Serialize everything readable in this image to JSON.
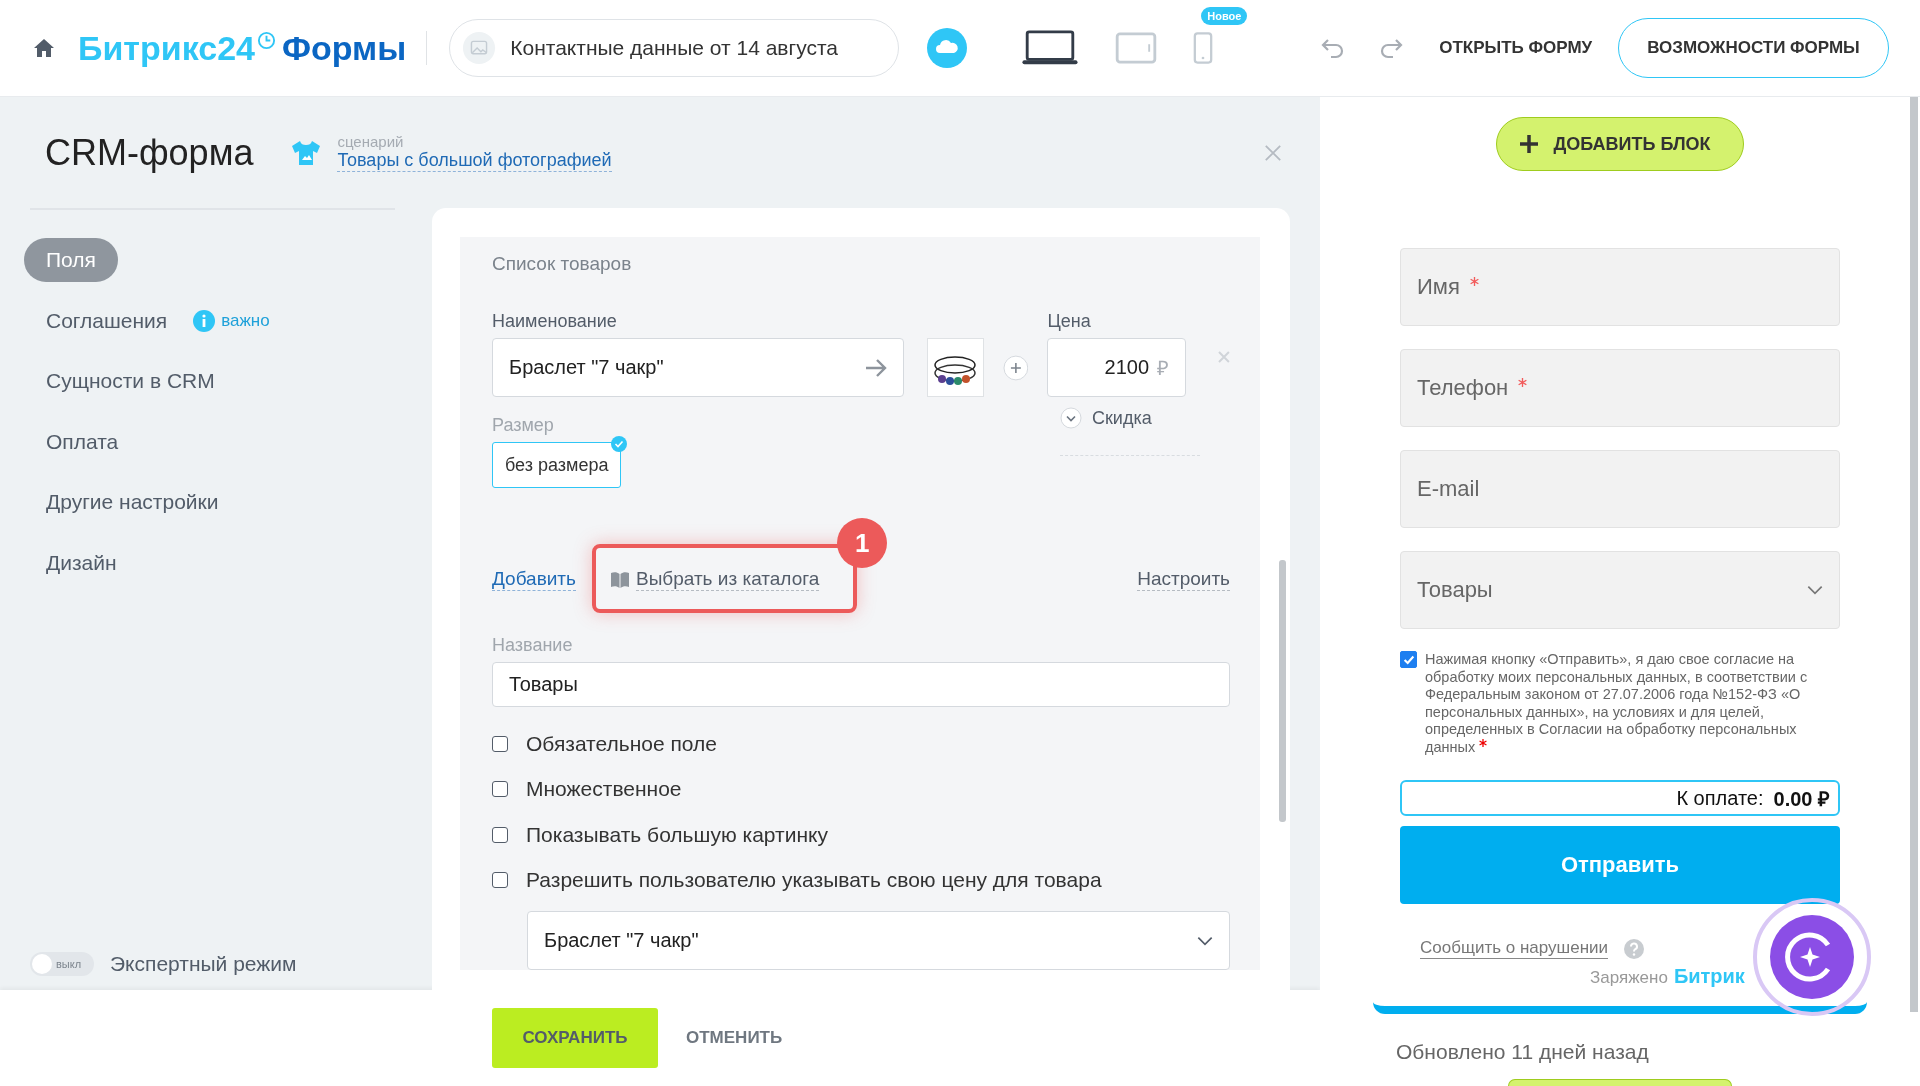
{
  "header": {
    "brand": "Битрикс24",
    "product": "Формы",
    "form_title": "Контактные данные от 14 августа",
    "devices": [
      {
        "kind": "desktop",
        "selected": true
      },
      {
        "kind": "tablet",
        "selected": false
      },
      {
        "kind": "phone",
        "selected": false,
        "badge": "Новое"
      }
    ],
    "open_form": "ОТКРЫТЬ ФОРМУ",
    "features_button": "ВОЗМОЖНОСТИ ФОРМЫ"
  },
  "sidebar": {
    "title": "CRM-форма",
    "scenario_label": "сценарий",
    "scenario_link": "Товары с большой фотографией",
    "items": [
      {
        "label": "Поля",
        "selected": true
      },
      {
        "label": "Соглашения",
        "selected": false,
        "badge": "важно"
      },
      {
        "label": "Сущности в CRM",
        "selected": false
      },
      {
        "label": "Оплата",
        "selected": false
      },
      {
        "label": "Другие настройки",
        "selected": false
      },
      {
        "label": "Дизайн",
        "selected": false
      }
    ],
    "expert_mode": {
      "label": "Экспертный режим",
      "on": false,
      "toggle_text": "выкл"
    }
  },
  "editor": {
    "section_title": "Список товаров",
    "name_label": "Наименование",
    "name_value": "Браслет \"7 чакр\"",
    "price_label": "Цена",
    "price_value": "2100",
    "currency": "₽",
    "discount": "Скидка",
    "size_label": "Размер",
    "size_option": {
      "label": "без размера",
      "selected": true
    },
    "actions": {
      "add": "Добавить",
      "catalog": "Выбрать из каталога",
      "configure": "Настроить",
      "annotation": "1"
    },
    "title_label": "Название",
    "title_value": "Товары",
    "options": [
      {
        "label": "Обязательное поле",
        "checked": false
      },
      {
        "label": "Множественное",
        "checked": false
      },
      {
        "label": "Показывать большую картинку",
        "checked": false
      },
      {
        "label": "Разрешить пользователю указывать свою цену для товара",
        "checked": false
      }
    ],
    "default_select": "Браслет \"7 чакр\""
  },
  "footer": {
    "save": "СОХРАНИТЬ",
    "cancel": "ОТМЕНИТЬ"
  },
  "preview": {
    "add_block": "ДОБАВИТЬ БЛОК",
    "fields": [
      {
        "kind": "input",
        "label": "Имя",
        "required": true
      },
      {
        "kind": "input",
        "label": "Телефон",
        "required": true
      },
      {
        "kind": "input",
        "label": "E-mail",
        "required": false
      },
      {
        "kind": "select",
        "label": "Товары",
        "required": false
      }
    ],
    "consent": {
      "checked": true,
      "required": true,
      "text": "Нажимая кнопку «Отправить», я даю свое согласие на обработку моих персональных данных, в соответствии с Федеральным законом от 27.07.2006 года №152-ФЗ «О персональных данных», на условиях и для целей, определенных в Согласии на обработку персональных данных"
    },
    "total_label": "К оплате:",
    "total_value": "0.00 ₽",
    "submit": "Отправить",
    "report": "Сообщить о нарушении",
    "powered_label": "Заряжено",
    "powered_brand": "Битрик",
    "updated": "Обновлено 11 дней назад"
  }
}
